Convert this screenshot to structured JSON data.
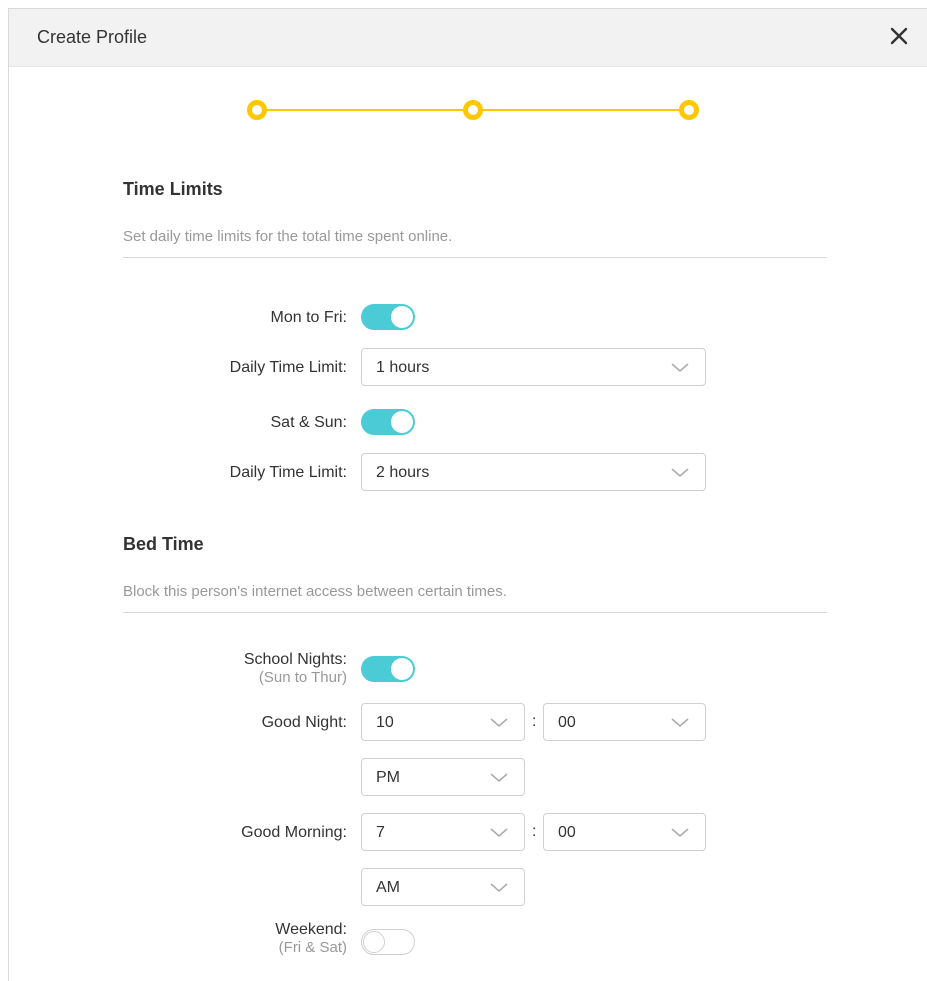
{
  "dialog": {
    "title": "Create Profile"
  },
  "stepper": {
    "steps": 3,
    "active_color": "#ffc700"
  },
  "time_limits": {
    "title": "Time Limits",
    "description": "Set daily time limits for the total time spent online.",
    "mon_fri_label": "Mon to Fri:",
    "mon_fri_enabled": true,
    "weekday_limit_label": "Daily Time Limit:",
    "weekday_limit_value": "1 hours",
    "sat_sun_label": "Sat & Sun:",
    "sat_sun_enabled": true,
    "weekend_limit_label": "Daily Time Limit:",
    "weekend_limit_value": "2 hours"
  },
  "bed_time": {
    "title": "Bed Time",
    "description": "Block this person's internet access between certain times.",
    "school_nights_label": "School Nights:",
    "school_nights_sub": "(Sun to Thur)",
    "school_nights_enabled": true,
    "good_night_label": "Good Night:",
    "good_night_hour": "10",
    "good_night_minute": "00",
    "good_night_ampm": "PM",
    "good_morning_label": "Good Morning:",
    "good_morning_hour": "7",
    "good_morning_minute": "00",
    "good_morning_ampm": "AM",
    "weekend_label": "Weekend:",
    "weekend_sub": "(Fri & Sat)",
    "weekend_enabled": false
  },
  "separator": ":",
  "colors": {
    "toggle_on": "#4acbd6",
    "accent": "#ffc700"
  },
  "icons": {
    "close": "close-icon",
    "dropdown": "chevron-down-icon"
  }
}
